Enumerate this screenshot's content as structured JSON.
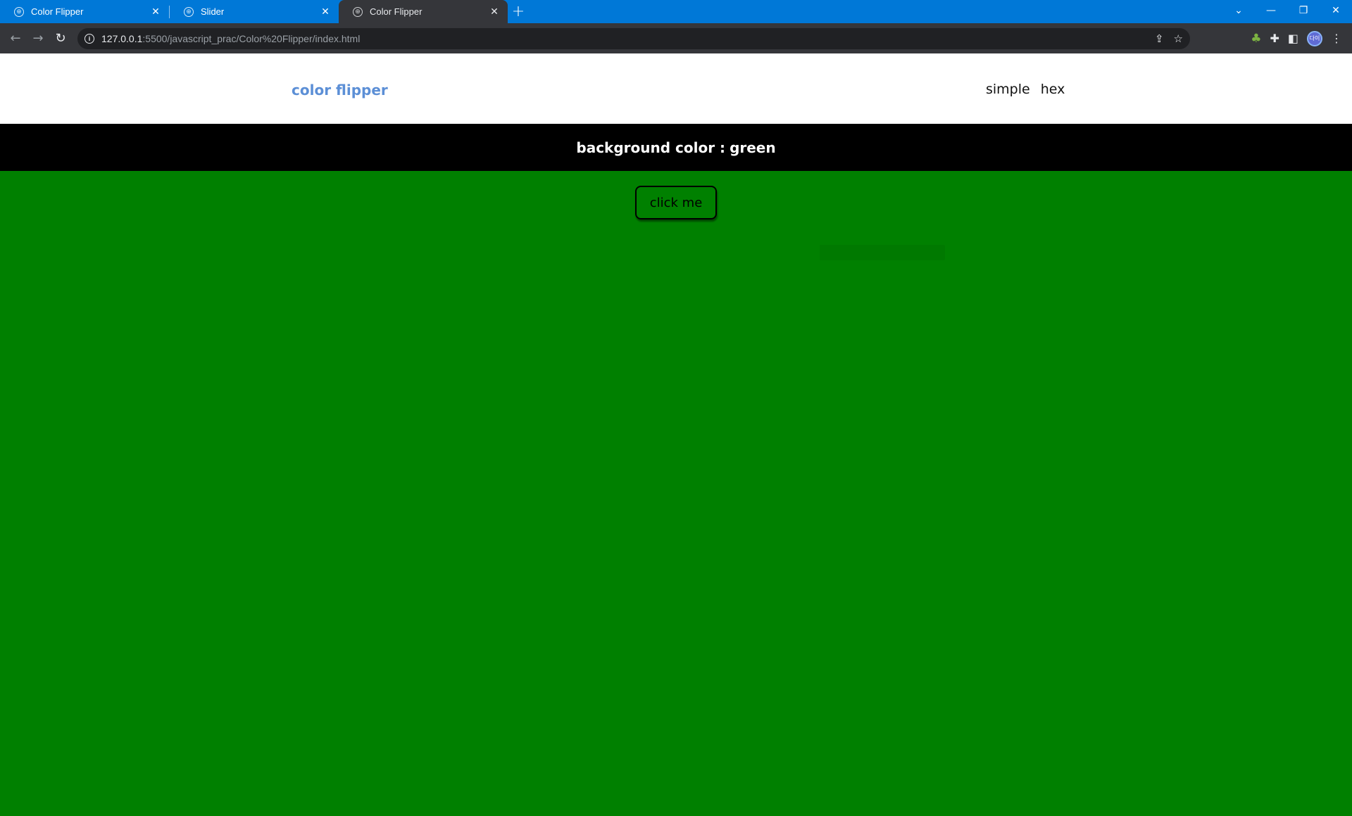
{
  "browser": {
    "tabs": [
      {
        "title": "Color Flipper",
        "active": false
      },
      {
        "title": "Slider",
        "active": false
      },
      {
        "title": "Color Flipper",
        "active": true
      }
    ],
    "new_tab_symbol": "+",
    "address": {
      "host": "127.0.0.1",
      "rest": ":5500/javascript_prac/Color%20Flipper/index.html"
    },
    "profile_initials": "다이"
  },
  "page": {
    "brand": "color flipper",
    "nav_links": [
      "simple",
      "hex"
    ],
    "banner_label": "background color :",
    "banner_value": "green",
    "button_label": "click me",
    "background_color": "#008000"
  },
  "icons": {
    "tab_favicon": "globe-icon",
    "back": "arrow-left-icon",
    "forward": "arrow-right-icon",
    "reload": "reload-icon",
    "site_info": "info-icon",
    "share": "share-icon",
    "bookmark": "star-icon",
    "extension_tree": "tree-icon",
    "extensions": "puzzle-icon",
    "side_panel": "side-panel-icon",
    "menu": "kebab-menu-icon"
  }
}
